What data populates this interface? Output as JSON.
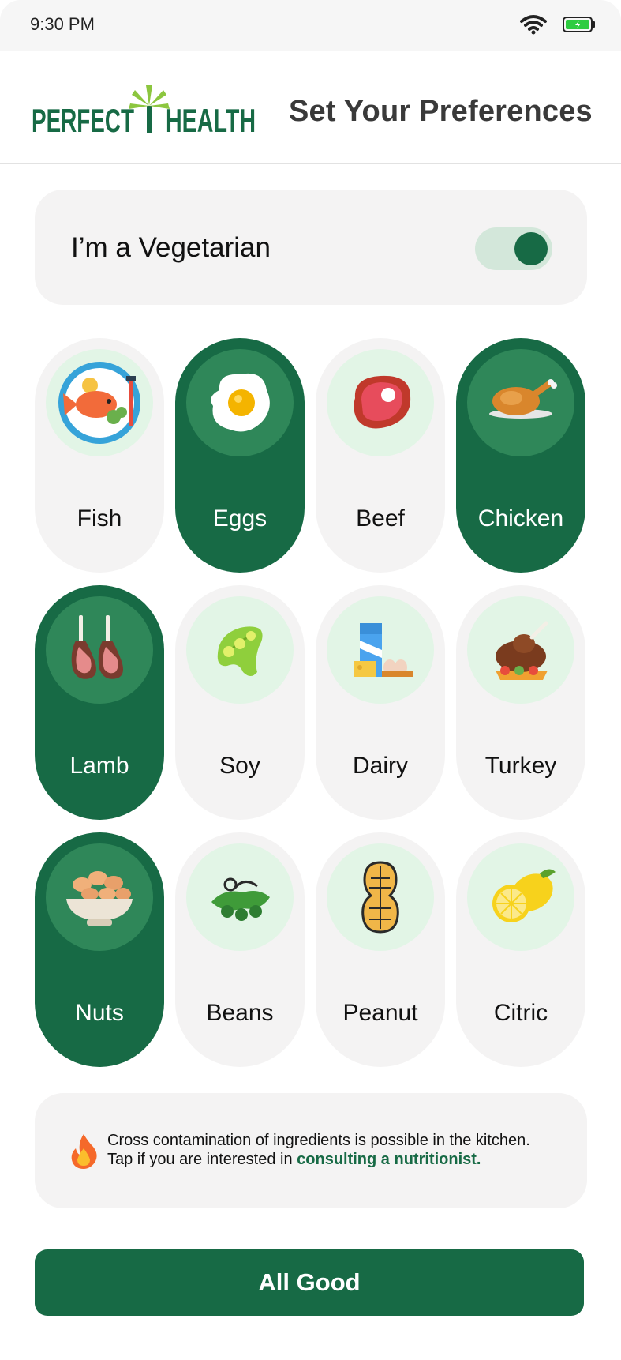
{
  "status_bar": {
    "time": "9:30 PM",
    "battery_icon": "battery-charging-icon",
    "wifi_icon": "wifi-icon"
  },
  "header": {
    "brand_left": "PERFECT",
    "brand_right": "HEALTH",
    "title": "Set Your Preferences"
  },
  "vegetarian": {
    "label": "I’m a Vegetarian",
    "enabled": true
  },
  "foods": [
    {
      "label": "Fish",
      "icon": "fish-plate-icon",
      "selected": false
    },
    {
      "label": "Eggs",
      "icon": "fried-egg-icon",
      "selected": true
    },
    {
      "label": "Beef",
      "icon": "steak-icon",
      "selected": false
    },
    {
      "label": "Chicken",
      "icon": "roast-chicken-icon",
      "selected": true
    },
    {
      "label": "Lamb",
      "icon": "lamb-chops-icon",
      "selected": true
    },
    {
      "label": "Soy",
      "icon": "soybean-pod-icon",
      "selected": false
    },
    {
      "label": "Dairy",
      "icon": "dairy-icon",
      "selected": false
    },
    {
      "label": "Turkey",
      "icon": "turkey-leg-icon",
      "selected": false
    },
    {
      "label": "Nuts",
      "icon": "nuts-bowl-icon",
      "selected": true
    },
    {
      "label": "Beans",
      "icon": "beans-icon",
      "selected": false
    },
    {
      "label": "Peanut",
      "icon": "peanut-icon",
      "selected": false
    },
    {
      "label": "Citric",
      "icon": "lemon-icon",
      "selected": false
    }
  ],
  "note": {
    "line1": "Cross contamination of ingredients is possible in the kitchen.",
    "line2_prefix": "Tap if you are interested in ",
    "link": "consulting a nutritionist.",
    "icon": "fire-icon"
  },
  "cta": {
    "label": "All Good"
  },
  "colors": {
    "primary": "#176a45",
    "card_bg": "#f4f3f3",
    "icon_bg": "#e2f5e6",
    "icon_bg_selected": "#2f8759"
  }
}
